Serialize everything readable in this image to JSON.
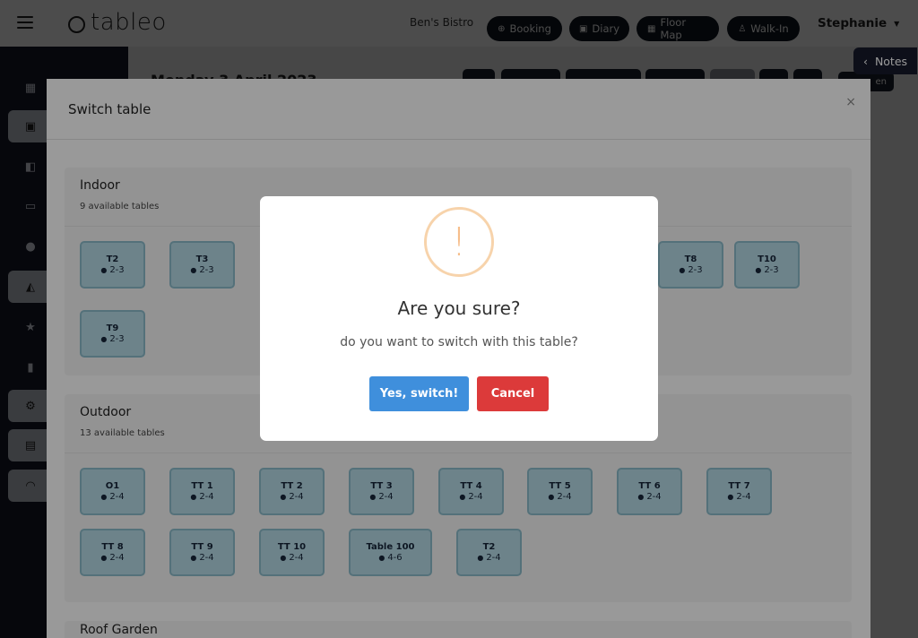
{
  "app": {
    "logo_text": "tableo",
    "venue": "Ben's Bistro",
    "user": "Stephanie"
  },
  "topnav": {
    "booking": "Booking",
    "diary": "Diary",
    "floor_map": "Floor Map",
    "walk_in": "Walk-In"
  },
  "notes_label": "Notes",
  "background": {
    "date": "Monday 3 April 2023",
    "show_btn": "en"
  },
  "modal": {
    "title": "Switch table",
    "close": "×",
    "sections": [
      {
        "name": "Indoor",
        "count": "9 available tables",
        "tables": [
          {
            "name": "T2",
            "cap": "2-3"
          },
          {
            "name": "T3",
            "cap": "2-3"
          },
          {
            "name": "T8",
            "cap": "2-3"
          },
          {
            "name": "T10",
            "cap": "2-3"
          },
          {
            "name": "T9",
            "cap": "2-3"
          }
        ]
      },
      {
        "name": "Outdoor",
        "count": "13 available tables",
        "tables": [
          {
            "name": "O1",
            "cap": "2-4"
          },
          {
            "name": "TT 1",
            "cap": "2-4"
          },
          {
            "name": "TT 2",
            "cap": "2-4"
          },
          {
            "name": "TT 3",
            "cap": "2-4"
          },
          {
            "name": "TT 4",
            "cap": "2-4"
          },
          {
            "name": "TT 5",
            "cap": "2-4"
          },
          {
            "name": "TT 6",
            "cap": "2-4"
          },
          {
            "name": "TT 7",
            "cap": "2-4"
          },
          {
            "name": "TT 8",
            "cap": "2-4"
          },
          {
            "name": "TT 9",
            "cap": "2-4"
          },
          {
            "name": "TT 10",
            "cap": "2-4"
          },
          {
            "name": "Table 100",
            "cap": "4-6"
          },
          {
            "name": "T2",
            "cap": "2-4"
          }
        ]
      },
      {
        "name": "Roof Garden"
      }
    ]
  },
  "alert": {
    "icon": "!",
    "title": "Are you sure?",
    "text": "do you want to switch with this table?",
    "confirm": "Yes, switch!",
    "cancel": "Cancel"
  },
  "icons": {
    "menu": "hamburger-icon",
    "booking": "plus-circle-icon",
    "diary": "calendar-icon",
    "floor_map": "map-icon",
    "walk_in": "walking-person-icon",
    "guest": "person-icon",
    "warning": "exclamation-icon"
  },
  "colors": {
    "sidebar": "#161a2b",
    "tile_bg": "#b6dbe7",
    "tile_border": "#8cbccb",
    "confirm": "#3f8fdc",
    "cancel": "#dc3a3a",
    "warning": "#f6bd8a"
  }
}
